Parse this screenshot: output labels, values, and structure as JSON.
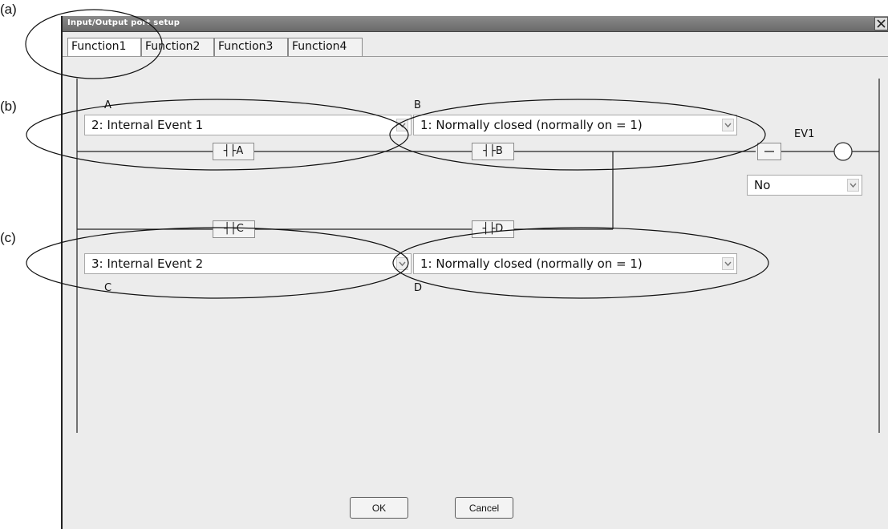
{
  "callouts": {
    "a": "(a)",
    "b": "(b)",
    "c": "(c)"
  },
  "window": {
    "title": "Input/Output port setup",
    "close_icon": "close-icon"
  },
  "tabs": [
    {
      "label": "Function1",
      "active": true
    },
    {
      "label": "Function2",
      "active": false
    },
    {
      "label": "Function3",
      "active": false
    },
    {
      "label": "Function4",
      "active": false
    }
  ],
  "ladder": {
    "labels": {
      "a": "A",
      "b": "B",
      "c": "C",
      "d": "D"
    },
    "selects": {
      "a": "2: Internal Event 1",
      "b": "1: Normally closed (normally on = 1)",
      "c": "3: Internal Event 2",
      "d": "1: Normally closed (normally on = 1)"
    },
    "contacts": {
      "a": "┤├A",
      "b": "┤├B",
      "c": "┤├C",
      "d": "┤├D"
    },
    "coil": {
      "label": "EV1",
      "output_select": "No"
    }
  },
  "buttons": {
    "ok": "OK",
    "cancel": "Cancel"
  },
  "colors": {
    "titlebar": "#7a7a7a",
    "panel": "#ececec",
    "annotation": "#111111"
  }
}
